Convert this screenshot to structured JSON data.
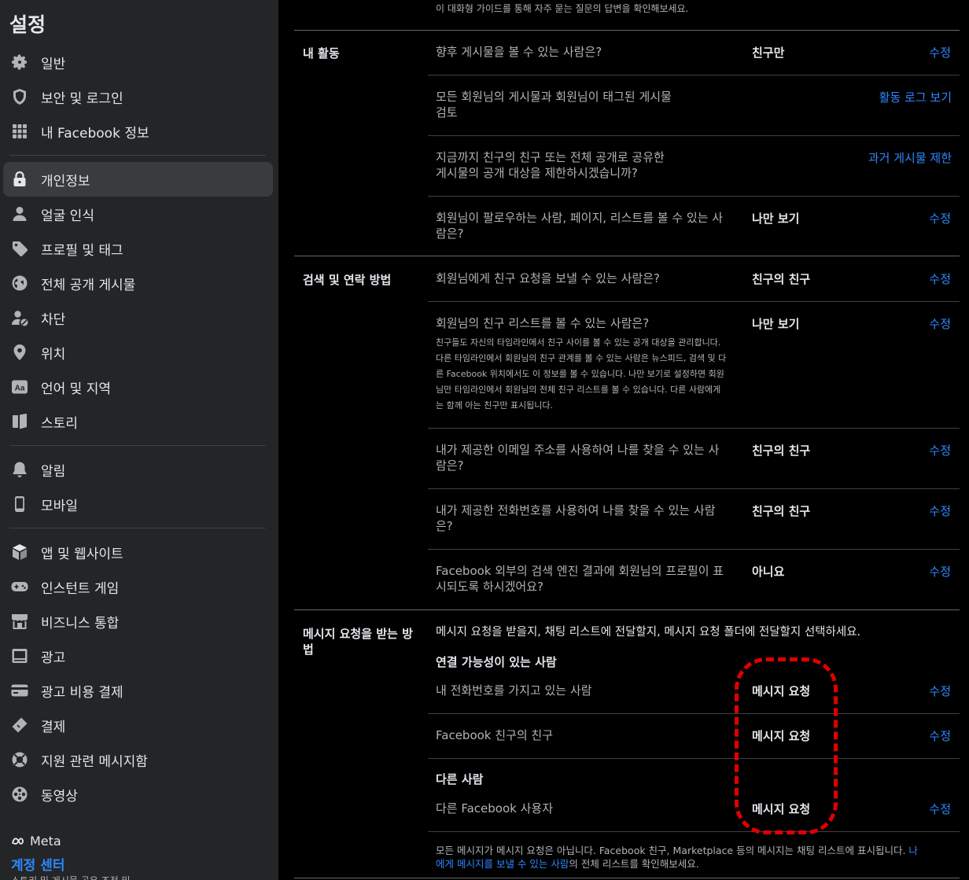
{
  "sidebar": {
    "title": "설정",
    "items": [
      {
        "label": "일반",
        "icon": "gear-icon"
      },
      {
        "label": "보안 및 로그인",
        "icon": "shield-icon"
      },
      {
        "label": "내 Facebook 정보",
        "icon": "grid-icon"
      },
      {
        "label": "개인정보",
        "icon": "lock-icon",
        "active": true
      },
      {
        "label": "얼굴 인식",
        "icon": "person-icon"
      },
      {
        "label": "프로필 및 태그",
        "icon": "tag-icon"
      },
      {
        "label": "전체 공개 게시물",
        "icon": "globe-icon"
      },
      {
        "label": "차단",
        "icon": "block-user-icon"
      },
      {
        "label": "위치",
        "icon": "location-pin-icon"
      },
      {
        "label": "언어 및 지역",
        "icon": "language-icon"
      },
      {
        "label": "스토리",
        "icon": "book-icon"
      },
      {
        "label": "알림",
        "icon": "bell-icon"
      },
      {
        "label": "모바일",
        "icon": "phone-icon"
      },
      {
        "label": "앱 및 웹사이트",
        "icon": "cube-icon"
      },
      {
        "label": "인스턴트 게임",
        "icon": "gamepad-icon"
      },
      {
        "label": "비즈니스 통합",
        "icon": "store-icon"
      },
      {
        "label": "광고",
        "icon": "ad-icon"
      },
      {
        "label": "광고 비용 결제",
        "icon": "credit-card-icon"
      },
      {
        "label": "결제",
        "icon": "payment-tag-icon"
      },
      {
        "label": "지원 관련 메시지함",
        "icon": "lifebuoy-icon"
      },
      {
        "label": "동영상",
        "icon": "film-reel-icon"
      }
    ],
    "meta_label": "Meta",
    "account_center": "계정 센터",
    "account_sub": "스토리 및 게시물 공유 조정 및 ..."
  },
  "main": {
    "top_hint": "이 대화형 가이드를 통해 자주 묻는 질문의 답변을 확인해보세요.",
    "activity": {
      "label": "내 활동",
      "rows": [
        {
          "q1": "향후 게시물을 볼 수 있는 사람은?",
          "value": "친구만",
          "action": "수정"
        },
        {
          "q1": "모든 회원님의 게시물과 회원님이 태그된 게시물",
          "q2": "검토",
          "action": "활동 로그 보기"
        },
        {
          "q1": "지금까지 친구의 친구 또는 전체 공개로 공유한",
          "q2": "게시물의 공개 대상을 제한하시겠습니까?",
          "action": "과거 게시물 제한"
        },
        {
          "q1": "회원님이 팔로우하는 사람, 페이지, 리스트를 볼 수 있는 사",
          "q2": "람은?",
          "value": "나만 보기",
          "action": "수정"
        }
      ]
    },
    "search": {
      "label": "검색 및 연락 방법",
      "rows": [
        {
          "q1": "회원님에게 친구 요청을 보낼 수 있는 사람은?",
          "value": "친구의 친구",
          "action": "수정"
        },
        {
          "q1": "회원님의 친구 리스트를 볼 수 있는 사람은?",
          "value": "나만 보기",
          "action": "수정",
          "desc": [
            "친구들도 자신의 타임라인에서 친구 사이를 볼 수 있는 공개 대상을 관리합니다.",
            "다른 타임라인에서 회원님의 친구 관계를 볼 수 있는 사람은 뉴스피드, 검색 및 다",
            "른 Facebook 위치에서도 이 정보를 볼 수 있습니다. 나만 보기로 설정하면 회원",
            "님만 타임라인에서 회원님의 전체 친구 리스트를 볼 수 있습니다. 다른 사람에게",
            "는 함께 아는 친구만 표시됩니다."
          ]
        },
        {
          "q1": "내가 제공한 이메일 주소를 사용하여 나를 찾을 수 있는 사",
          "q2": "람은?",
          "value": "친구의 친구",
          "action": "수정"
        },
        {
          "q1": "내가 제공한 전화번호를 사용하여 나를 찾을 수 있는 사람",
          "q2": "은?",
          "value": "친구의 친구",
          "action": "수정"
        },
        {
          "q1": "Facebook 외부의 검색 엔진 결과에 회원님의 프로필이 표",
          "q2": "시되도록 하시겠어요?",
          "value": "아니요",
          "action": "수정"
        }
      ]
    },
    "messages": {
      "label1": "메시지 요청을 받는 방",
      "label2": "법",
      "intro": "메시지 요청을 받을지, 채팅 리스트에 전달할지, 메시지 요청 폴더에 전달할지 선택하세요.",
      "group1": "연결 가능성이 있는 사람",
      "group2": "다른 사람",
      "rows": [
        {
          "q1": "내 전화번호를 가지고 있는 사람",
          "value": "메시지 요청",
          "action": "수정"
        },
        {
          "q1": "Facebook 친구의 친구",
          "value": "메시지 요청",
          "action": "수정"
        },
        {
          "q1": "다른 Facebook 사용자",
          "value": "메시지 요청",
          "action": "수정"
        }
      ],
      "footer1": "모든 메시지가 메시지 요청은 아닙니다. Facebook 친구, Marketplace 등의 메시지는 채팅 리스트에 표시됩니다.",
      "footer_link_a": "나",
      "footer_link_b": "에게 메시지를 보낼 수 있는 사람",
      "footer2": "의 전체 리스트를 확인해보세요."
    }
  },
  "colors": {
    "accent": "#2d88ff",
    "highlight": "#e00000",
    "sidebar_bg": "#242526"
  }
}
